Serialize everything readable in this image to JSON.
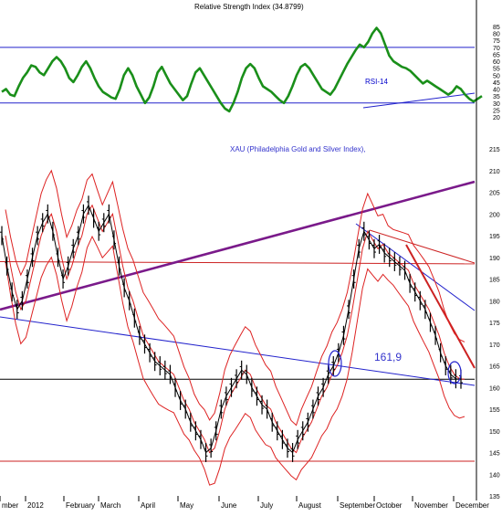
{
  "chart_data": [
    {
      "type": "line",
      "title": "Relative Strength Index (34.8799)",
      "indicator_label": "RSI-14",
      "y_ticks": [
        20,
        25,
        30,
        35,
        40,
        45,
        50,
        55,
        60,
        65,
        70,
        75,
        80,
        85
      ],
      "ylim": [
        20,
        85
      ],
      "overbought_level": 70,
      "oversold_level": 30,
      "last_value": 34.8799,
      "series": [
        {
          "values": [
            38,
            40,
            36,
            35,
            42,
            48,
            52,
            57,
            56,
            52,
            50,
            55,
            60,
            63,
            60,
            55,
            48,
            45,
            50,
            56,
            60,
            55,
            48,
            42,
            38,
            36,
            34,
            33,
            40,
            50,
            55,
            50,
            42,
            36,
            30,
            34,
            42,
            52,
            56,
            50,
            44,
            40,
            36,
            32,
            35,
            44,
            52,
            55,
            50,
            45,
            40,
            35,
            30,
            26,
            24,
            30,
            38,
            48,
            55,
            58,
            55,
            48,
            42,
            40,
            38,
            35,
            32,
            30,
            35,
            42,
            50,
            56,
            58,
            55,
            50,
            45,
            40,
            38,
            36,
            40,
            46,
            52,
            58,
            63,
            68,
            72,
            70,
            74,
            80,
            84,
            80,
            72,
            64,
            60,
            58,
            56,
            55,
            53,
            50,
            47,
            44,
            46,
            44,
            42,
            40,
            38,
            36,
            38,
            42,
            40,
            36,
            33,
            31,
            33,
            35
          ]
        }
      ]
    },
    {
      "type": "line",
      "title": "XAU  (Philadelphia Gold and Silver Index),",
      "callout": "161,9",
      "y_ticks": [
        135,
        140,
        145,
        150,
        155,
        160,
        165,
        170,
        175,
        180,
        185,
        190,
        195,
        200,
        205,
        210,
        215
      ],
      "ylim": [
        135,
        218
      ],
      "x_labels": [
        "mber",
        "2012",
        "February",
        "March",
        "April",
        "May",
        "June",
        "July",
        "August",
        "September",
        "October",
        "November",
        "December"
      ],
      "support_level": 143,
      "highlight_level": 161.9,
      "series": [
        {
          "values": [
            195,
            188,
            182,
            178,
            180,
            185,
            190,
            195,
            198,
            200,
            196,
            190,
            185,
            188,
            192,
            195,
            200,
            202,
            199,
            196,
            198,
            200,
            194,
            188,
            183,
            180,
            176,
            172,
            170,
            168,
            166,
            165,
            164,
            163,
            160,
            157,
            155,
            152,
            150,
            148,
            145,
            146,
            150,
            155,
            158,
            160,
            162,
            164,
            163,
            160,
            158,
            156,
            155,
            152,
            150,
            148,
            146,
            145,
            148,
            150,
            152,
            155,
            158,
            160,
            163,
            165,
            168,
            172,
            178,
            185,
            192,
            196,
            194,
            192,
            193,
            191,
            190,
            189,
            188,
            187,
            184,
            182,
            180,
            178,
            175,
            172,
            168,
            165,
            163,
            162,
            161.9
          ]
        }
      ]
    }
  ]
}
